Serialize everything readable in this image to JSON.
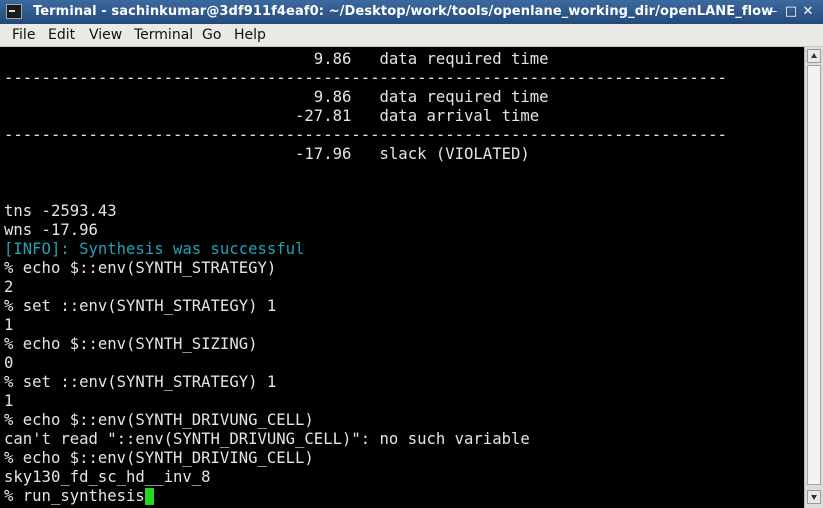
{
  "window": {
    "title": "Terminal - sachinkumar@3df911f4eaf0: ~/Desktop/work/tools/openlane_working_dir/openLANE_flow",
    "buttons": {
      "minimize": "–",
      "maximize": "□",
      "close": "✕"
    }
  },
  "menu": [
    "File",
    "Edit",
    "View",
    "Terminal",
    "Go",
    "Help"
  ],
  "terminal": {
    "lines": [
      {
        "text": "                                 9.86   data required time",
        "kind": "normal"
      },
      {
        "text": "-----------------------------------------------------------------------------",
        "kind": "normal"
      },
      {
        "text": "                                 9.86   data required time",
        "kind": "normal"
      },
      {
        "text": "                               -27.81   data arrival time",
        "kind": "normal"
      },
      {
        "text": "-----------------------------------------------------------------------------",
        "kind": "normal"
      },
      {
        "text": "                               -17.96   slack (VIOLATED)",
        "kind": "normal"
      },
      {
        "text": "",
        "kind": "normal"
      },
      {
        "text": "",
        "kind": "normal"
      },
      {
        "text": "tns -2593.43",
        "kind": "normal"
      },
      {
        "text": "wns -17.96",
        "kind": "normal"
      },
      {
        "text": "[INFO]: Synthesis was successful",
        "kind": "info"
      },
      {
        "text": "% echo $::env(SYNTH_STRATEGY)",
        "kind": "normal"
      },
      {
        "text": "2",
        "kind": "normal"
      },
      {
        "text": "% set ::env(SYNTH_STRATEGY) 1",
        "kind": "normal"
      },
      {
        "text": "1",
        "kind": "normal"
      },
      {
        "text": "% echo $::env(SYNTH_SIZING)",
        "kind": "normal"
      },
      {
        "text": "0",
        "kind": "normal"
      },
      {
        "text": "% set ::env(SYNTH_STRATEGY) 1",
        "kind": "normal"
      },
      {
        "text": "1",
        "kind": "normal"
      },
      {
        "text": "% echo $::env(SYNTH_DRIVUNG_CELL)",
        "kind": "normal"
      },
      {
        "text": "can't read \"::env(SYNTH_DRIVUNG_CELL)\": no such variable",
        "kind": "normal"
      },
      {
        "text": "% echo $::env(SYNTH_DRIVING_CELL)",
        "kind": "normal"
      },
      {
        "text": "sky130_fd_sc_hd__inv_8",
        "kind": "normal"
      }
    ],
    "prompt_line": "% run_synthesis"
  }
}
